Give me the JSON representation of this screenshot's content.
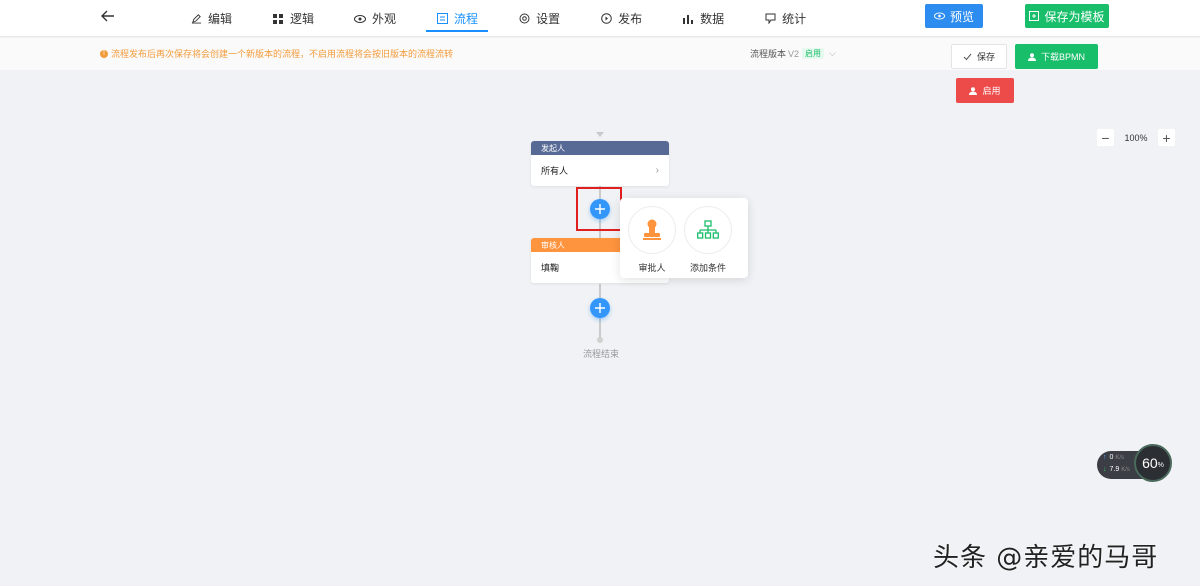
{
  "nav": {
    "items": [
      {
        "label": "编辑",
        "icon": "edit-icon"
      },
      {
        "label": "逻辑",
        "icon": "grid-icon"
      },
      {
        "label": "外观",
        "icon": "eye-icon"
      },
      {
        "label": "流程",
        "icon": "flow-icon",
        "active": true
      },
      {
        "label": "设置",
        "icon": "gear-icon"
      },
      {
        "label": "发布",
        "icon": "publish-icon"
      },
      {
        "label": "数据",
        "icon": "bar-chart-icon"
      },
      {
        "label": "统计",
        "icon": "stats-icon"
      }
    ],
    "preview_label": "预览",
    "save_template_label": "保存为模板"
  },
  "notice": {
    "text": "流程发布后再次保存将会创建一个新版本的流程，不启用流程将会按旧版本的流程流转",
    "version_label": "流程版本",
    "version_value": "V2",
    "version_tag": "启用"
  },
  "actions": {
    "save_label": "保存",
    "download_label": "下载BPMN",
    "enable_label": "启用"
  },
  "zoom": {
    "minus": "−",
    "value": "100%",
    "plus": "+"
  },
  "flow": {
    "initiator": {
      "title": "发起人",
      "content": "所有人"
    },
    "approver": {
      "title": "审核人",
      "content": "填鞠"
    },
    "end_label": "流程结束"
  },
  "popover": {
    "approver_label": "审批人",
    "condition_label": "添加条件"
  },
  "network": {
    "up": "0",
    "up_unit": "K/s",
    "down": "7.9",
    "down_unit": "K/s",
    "percent": "60",
    "percent_unit": "%"
  },
  "watermark": "头条 @亲爱的马哥",
  "colors": {
    "primary": "#1890ff",
    "green": "#19be6b",
    "red": "#ed4a4a",
    "initiator": "#576a95",
    "approver": "#ff943e"
  }
}
